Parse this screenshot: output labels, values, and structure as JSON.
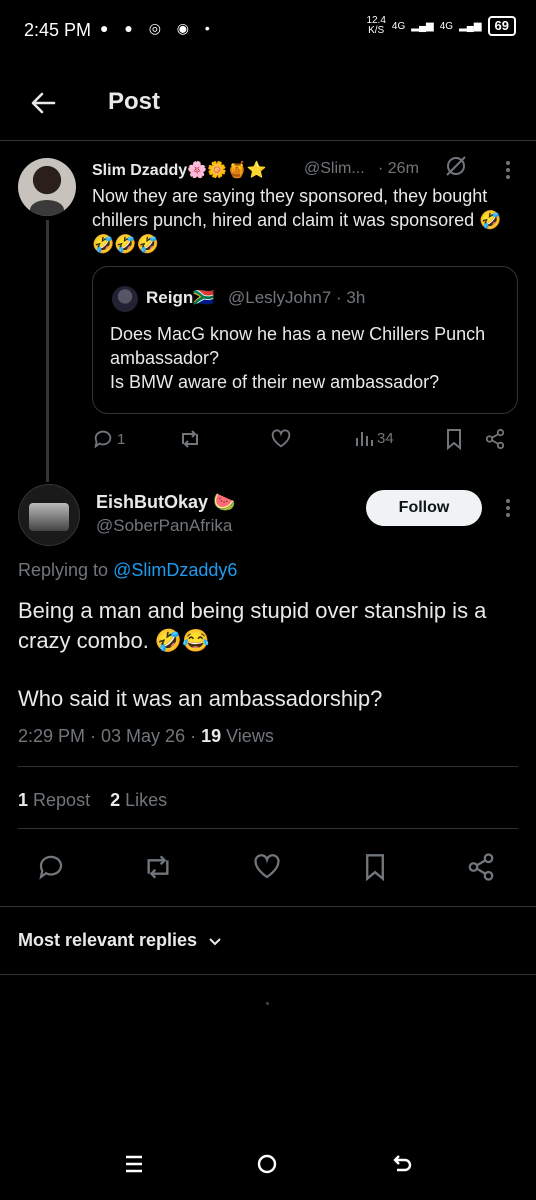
{
  "status_bar": {
    "time": "2:45 PM",
    "net_speed": "12.4",
    "net_unit": "K/S",
    "signal1": "4G",
    "signal2": "4G",
    "battery": "69"
  },
  "header": {
    "title": "Post"
  },
  "parent_post": {
    "author_name": "Slim Dzaddy🌸🌼🍯⭐",
    "handle": "@Slim...",
    "time": "· 26m",
    "text": "Now they are saying they sponsored, they bought chillers punch, hired and claim it was sponsored 🤣🤣🤣🤣",
    "quote": {
      "author_name": "Reign🇿🇦",
      "handle": "@LeslyJohn7 · 3h",
      "text": "Does MacG know he has a new Chillers Punch ambassador?\nIs BMW aware of their new ambassador?"
    },
    "replies_count": "1",
    "views_count": "34"
  },
  "main_post": {
    "author_name": "EishButOkay 🍉",
    "handle": "@SoberPanAfrika",
    "follow_label": "Follow",
    "replying_to_prefix": "Replying to",
    "replying_to_mention": "@SlimDzaddy6",
    "text_line1": "Being a man and being stupid over stanship is a crazy combo. 🤣😂",
    "text_line2": "Who said it was an ambassadorship?",
    "timestamp": "2:29 PM · 03 May 26 · ",
    "views_count": "19",
    "views_label": "Views",
    "reposts_count": "1",
    "reposts_label": "Repost",
    "likes_count": "2",
    "likes_label": "Likes"
  },
  "replies_sort": {
    "label": "Most relevant replies"
  },
  "colors": {
    "accent": "#1d9bf0",
    "muted": "#71767b",
    "text": "#e7e9ea",
    "background": "#000000"
  }
}
